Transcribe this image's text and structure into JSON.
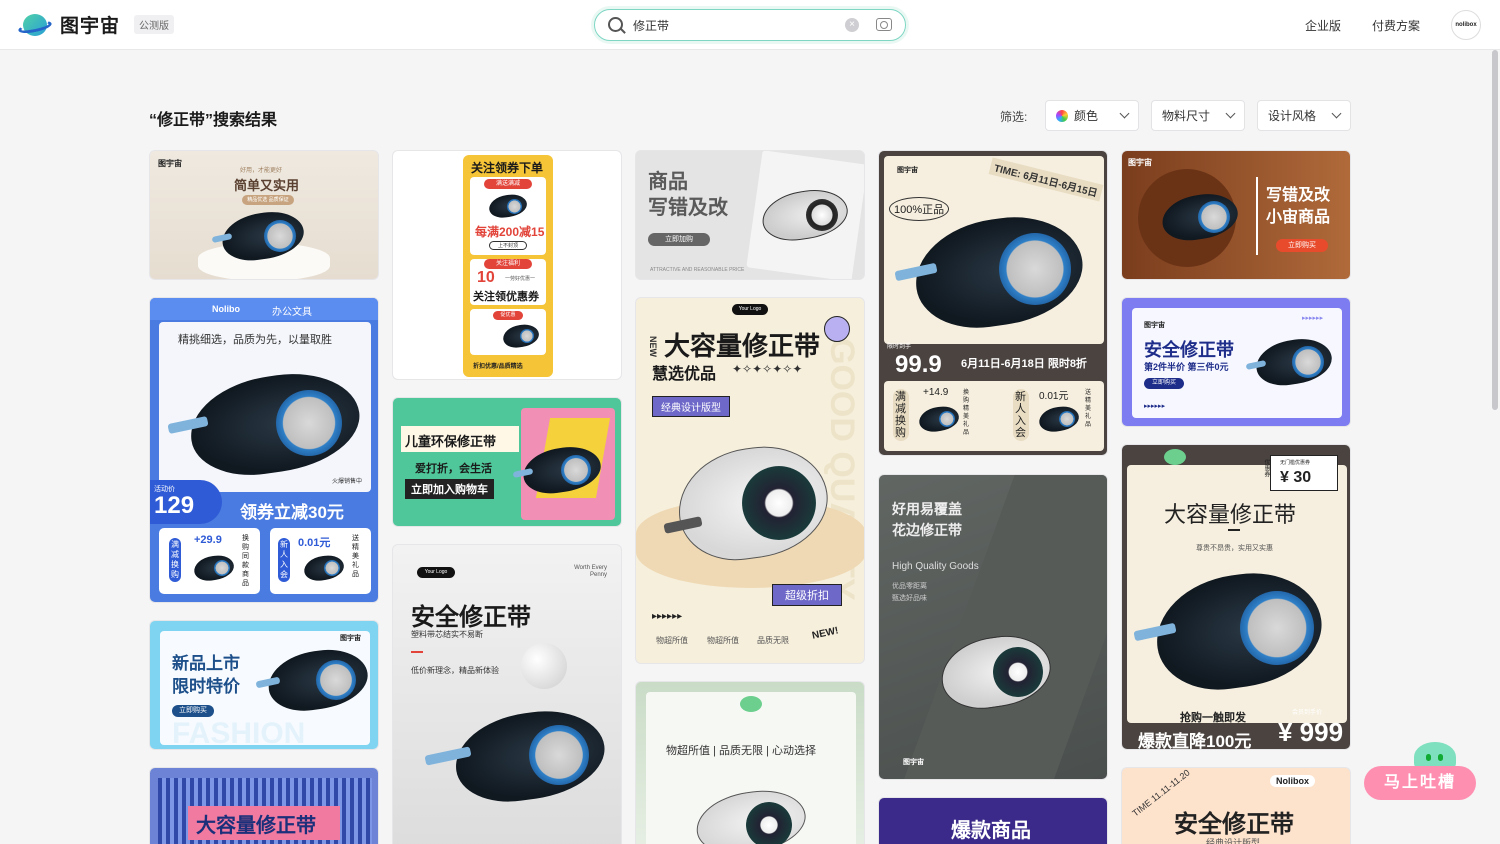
{
  "header": {
    "logo_text": "图宇宙",
    "beta_label": "公测版",
    "search_value": "修正带",
    "enterprise_link": "企业版",
    "pricing_link": "付费方案",
    "avatar_text": "nolibox"
  },
  "results": {
    "title": "“修正带”搜索结果",
    "filter_label": "筛选:",
    "filters": [
      "颜色",
      "物料尺寸",
      "设计风格"
    ]
  },
  "cards": {
    "c1": {
      "brand": "图宇宙",
      "tagline": "好用，才能更好",
      "title": "简单又实用",
      "sub": "精品优选 品质保证"
    },
    "c2": {
      "brand": "Nolibo",
      "category": "办公文具",
      "subtitle": "精挑细选，品质为先，以量取胜",
      "label_event": "活动价",
      "price": "129",
      "hot": "火爆销售中",
      "coupon": "领券立减30元",
      "b1_tag": "满减换购",
      "b1_price": "+29.9",
      "b1_desc": "换购同款商品",
      "b2_tag": "新人入会",
      "b2_price": "0.01元",
      "b2_desc": "送精美礼品"
    },
    "c3": {
      "brand": "图宇宙",
      "title1": "新品上市",
      "title2": "限时特价",
      "button": "立即购买",
      "watermark": "FASHION"
    },
    "c4": {
      "title": "大容量修正带"
    },
    "c5": {
      "top": "关注领券下单",
      "badge1": "满送满减",
      "deal": "每满200减15",
      "tag1": "上不封顶",
      "badge2": "关注福利",
      "value": "10",
      "sub": "一劳好优惠一",
      "bottom": "关注领优惠券",
      "badge3": "促优惠",
      "footer": "折扣优惠/品质精选"
    },
    "c6": {
      "title": "儿童环保修正带",
      "sub": "爱打折，会生活",
      "button": "立即加入购物车"
    },
    "c7": {
      "logo": "Your Logo",
      "corner": "Worth Every Penny",
      "title": "安全修正带",
      "sub": "塑料带芯结实不易断",
      "slogan": "低价新理念，精品新体验"
    },
    "c8": {
      "title1": "商品",
      "title2": "写错及改",
      "button": "立即加购",
      "footer": "ATTRACTIVE AND REASONABLE PRICE"
    },
    "c9": {
      "logo": "Your Logo",
      "side": "NEW",
      "title": "大容量修正带",
      "sub": "慧选优品",
      "stars": "✦✧✦✧✦✧✦",
      "tag": "经典设计版型",
      "promo": "超级折扣",
      "arrows": "▸▸▸▸▸▸",
      "f1": "物超所值",
      "f2": "物超所值",
      "f3": "品质无限",
      "new": "NEW!",
      "bg_word": "GOOD QUALITY"
    },
    "c10": {
      "slogan": "物超所值 | 品质无限 | 心动选择"
    },
    "c11": {
      "brand": "图宇宙",
      "time": "TIME: 6月11日-6月15日",
      "badge": "100%正品",
      "label": "限时到手",
      "price": "99.9",
      "dates": "6月11日-6月18日 限时8折",
      "b1_tag": "满减换购",
      "b1_price": "+14.9",
      "b1_desc": "换购精美礼品",
      "b2_tag": "新人入会",
      "b2_price": "0.01元",
      "b2_desc": "送精美礼品"
    },
    "c12": {
      "title1": "好用易覆盖",
      "title2": "花边修正带",
      "sub": "High Quality Goods",
      "desc1": "优品零距离",
      "desc2": "甄选好品味",
      "brand": "图宇宙"
    },
    "c13": {
      "title": "爆款商品"
    },
    "c14": {
      "brand": "图宇宙",
      "title1": "写错及改",
      "title2": "小宙商品",
      "button": "立即购买"
    },
    "c15": {
      "brand": "图宇宙",
      "arrows_top": "▸▸▸▸▸▸",
      "title": "安全修正带",
      "sub": "第2件半价 第三件0元",
      "button": "立即购买",
      "arrows": "▸▸▸▸▸▸"
    },
    "c16": {
      "corner_label": "优惠券",
      "corner_sub": "无门槛优惠券",
      "coupon_price": "¥ 30",
      "title": "大容量修正带",
      "sub": "尊贵不昂贵，实用又实惠",
      "promo": "抢购一触即发",
      "bottom": "爆款直降100元",
      "member": "会员到手价",
      "price": "¥ 999"
    },
    "c17": {
      "time": "TIME 11.11-11.20",
      "brand": "Nolibox",
      "title": "安全修正带",
      "sub": "经典设计版型"
    }
  },
  "feedback": {
    "label": "马上吐槽"
  },
  "colors": {
    "accent": "#7ed6c3",
    "blue": "#2f5bd6",
    "brown": "#9b5a32",
    "dark": "#4a4340",
    "yellow": "#f5c437",
    "purple": "#3b2a8a",
    "pink": "#ff8fb1"
  }
}
